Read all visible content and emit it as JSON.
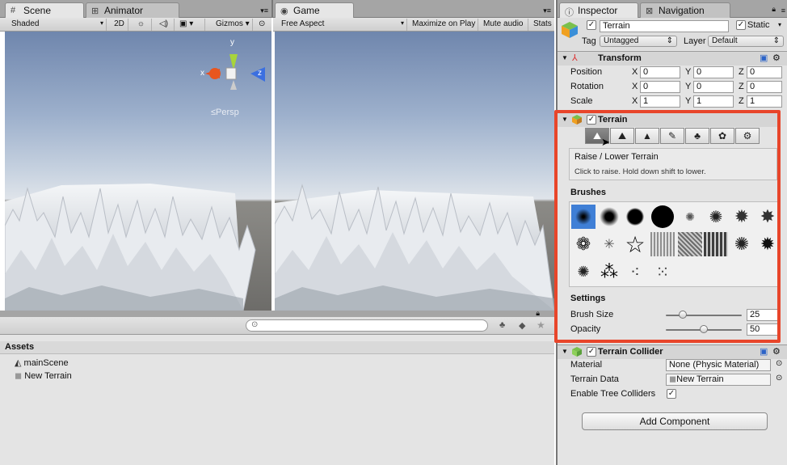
{
  "scene_panel": {
    "tab_scene": "Scene",
    "tab_animator": "Animator",
    "shading": "Shaded",
    "mode_2d": "2D",
    "gizmos": "Gizmos",
    "persp": "Persp",
    "axis_x": "x",
    "axis_y": "y",
    "axis_z": "z"
  },
  "game_panel": {
    "tab": "Game",
    "aspect": "Free Aspect",
    "maximize": "Maximize on Play",
    "mute": "Mute audio",
    "stats": "Stats"
  },
  "project_panel": {
    "assets_label": "Assets",
    "items": [
      {
        "label": "mainScene",
        "icon": "unity-scene-icon"
      },
      {
        "label": "New Terrain",
        "icon": "terrain-asset-icon"
      }
    ]
  },
  "inspector": {
    "tab_inspector": "Inspector",
    "tab_navigation": "Navigation",
    "object_name": "Terrain",
    "static_label": "Static",
    "tag_label": "Tag",
    "tag_value": "Untagged",
    "layer_label": "Layer",
    "layer_value": "Default",
    "transform": {
      "title": "Transform",
      "rows": [
        {
          "label": "Position",
          "x": "0",
          "y": "0",
          "z": "0"
        },
        {
          "label": "Rotation",
          "x": "0",
          "y": "0",
          "z": "0"
        },
        {
          "label": "Scale",
          "x": "1",
          "y": "1",
          "z": "1"
        }
      ],
      "axis_x": "X",
      "axis_y": "Y",
      "axis_z": "Z"
    },
    "terrain": {
      "title": "Terrain",
      "tool_title": "Raise / Lower Terrain",
      "tool_hint": "Click to raise. Hold down shift to lower.",
      "brushes_label": "Brushes",
      "settings_label": "Settings",
      "brush_size_label": "Brush Size",
      "brush_size": "25",
      "brush_size_fraction": 0.22,
      "opacity_label": "Opacity",
      "opacity": "50",
      "opacity_fraction": 0.5,
      "tools": [
        "raise-lower-icon",
        "paint-height-icon",
        "smooth-height-icon",
        "paint-texture-icon",
        "place-trees-icon",
        "paint-details-icon",
        "settings-gear-icon"
      ]
    },
    "collider": {
      "title": "Terrain Collider",
      "material_label": "Material",
      "material_value": "None (Physic Material)",
      "data_label": "Terrain Data",
      "data_value": "New Terrain",
      "trees_label": "Enable Tree Colliders"
    },
    "add_component": "Add Component"
  },
  "colors": {
    "highlight": "#e8452a",
    "tab_bg": "#a5a5a5",
    "panel_bg": "#e4e4e4"
  }
}
